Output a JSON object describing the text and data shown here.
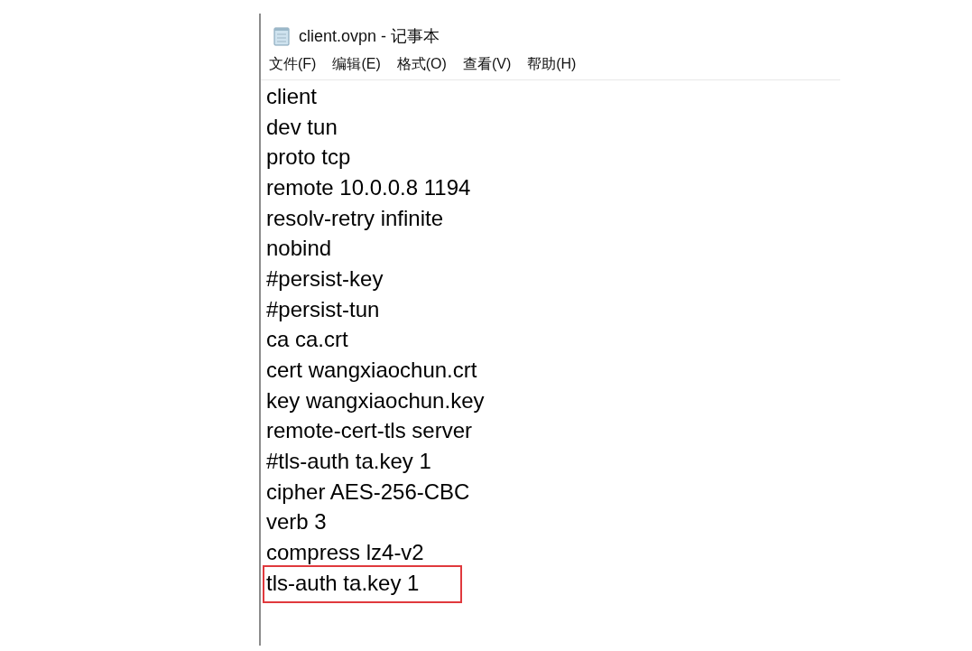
{
  "window": {
    "title": "client.ovpn - 记事本"
  },
  "menu": [
    {
      "label": "文件(F)"
    },
    {
      "label": "编辑(E)"
    },
    {
      "label": "格式(O)"
    },
    {
      "label": "查看(V)"
    },
    {
      "label": "帮助(H)"
    }
  ],
  "lines": [
    {
      "text": "client",
      "highlighted": false
    },
    {
      "text": "dev tun",
      "highlighted": false
    },
    {
      "text": "proto tcp",
      "highlighted": false
    },
    {
      "text": "remote 10.0.0.8 1194",
      "highlighted": false
    },
    {
      "text": "resolv-retry infinite",
      "highlighted": false
    },
    {
      "text": "nobind",
      "highlighted": false
    },
    {
      "text": "#persist-key",
      "highlighted": false
    },
    {
      "text": "#persist-tun",
      "highlighted": false
    },
    {
      "text": "ca ca.crt",
      "highlighted": false
    },
    {
      "text": "cert wangxiaochun.crt",
      "highlighted": false
    },
    {
      "text": "key wangxiaochun.key",
      "highlighted": false
    },
    {
      "text": "remote-cert-tls server",
      "highlighted": false
    },
    {
      "text": "#tls-auth ta.key 1",
      "highlighted": false
    },
    {
      "text": "cipher AES-256-CBC",
      "highlighted": false
    },
    {
      "text": "verb 3",
      "highlighted": false
    },
    {
      "text": "compress lz4-v2",
      "highlighted": false
    },
    {
      "text": "tls-auth ta.key 1",
      "highlighted": true
    }
  ]
}
